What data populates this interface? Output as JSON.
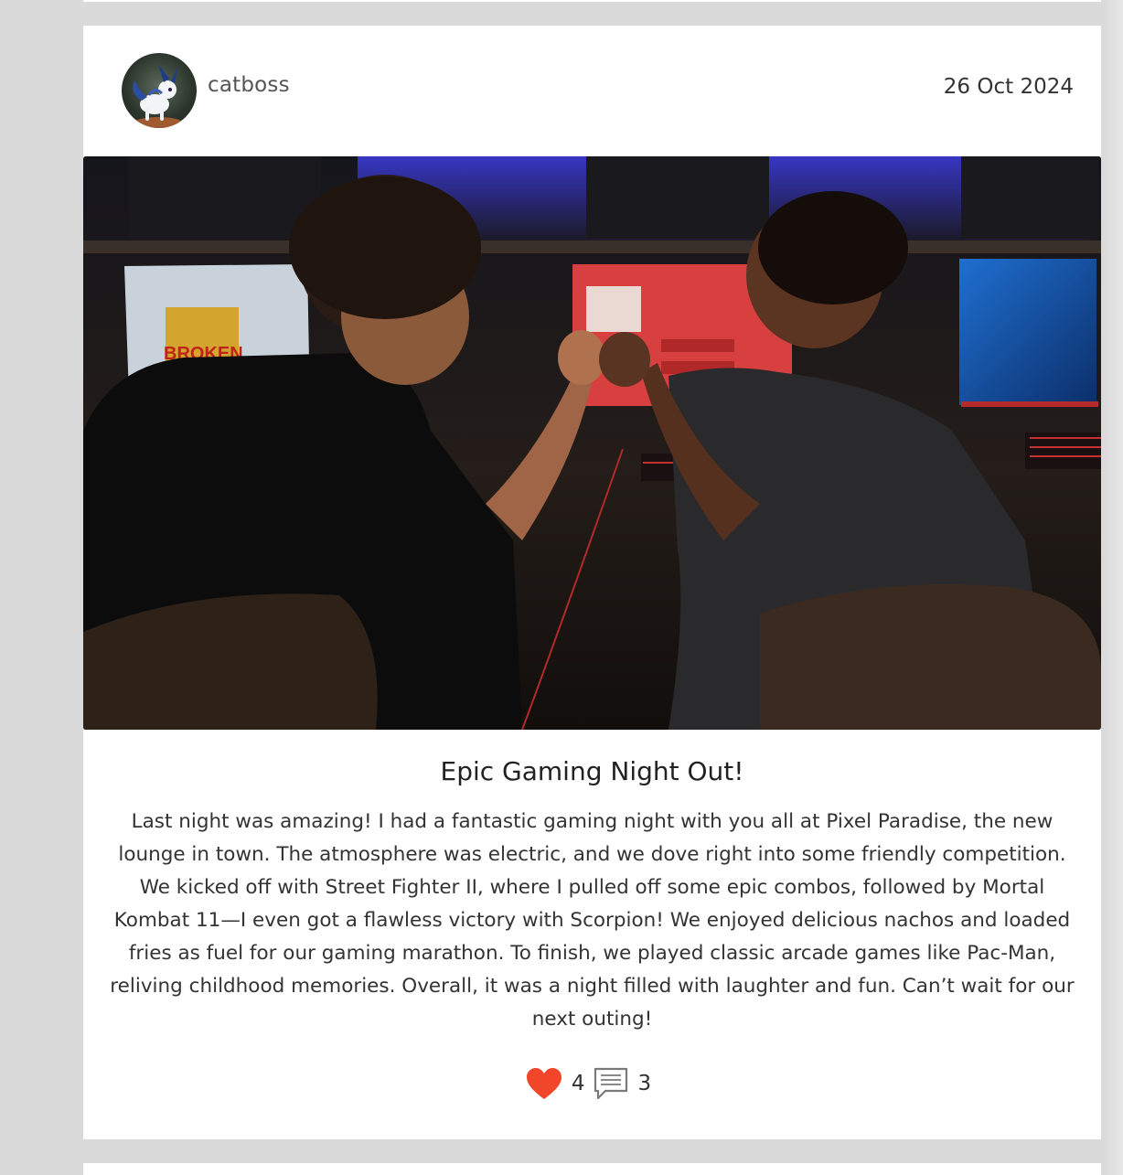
{
  "post": {
    "author": {
      "username": "catboss",
      "avatar_icon": "avatar-icon"
    },
    "date": "26 Oct 2024",
    "image_icon": "photo-icon",
    "title": "Epic Gaming Night Out!",
    "body": "Last night was amazing! I had a fantastic gaming night with you all at Pixel Paradise, the new lounge in town. The atmosphere was electric, and we dove right into some friendly competition. We kicked off with Street Fighter II, where I pulled off some epic combos, followed by Mortal Kombat 11—I even got a flawless victory with Scorpion! We enjoyed delicious nachos and loaded fries as fuel for our gaming marathon. To finish, we played classic arcade games like Pac-Man, reliving childhood memories. Overall, it was a night filled with laughter and fun. Can’t wait for our next outing!",
    "likes": {
      "count": "4",
      "icon": "heart-icon",
      "color": "#f2462b"
    },
    "comments": {
      "count": "3",
      "icon": "comment-icon"
    }
  },
  "colors": {
    "page_background": "#dadada",
    "card_background": "#ffffff",
    "text": "#333333"
  }
}
